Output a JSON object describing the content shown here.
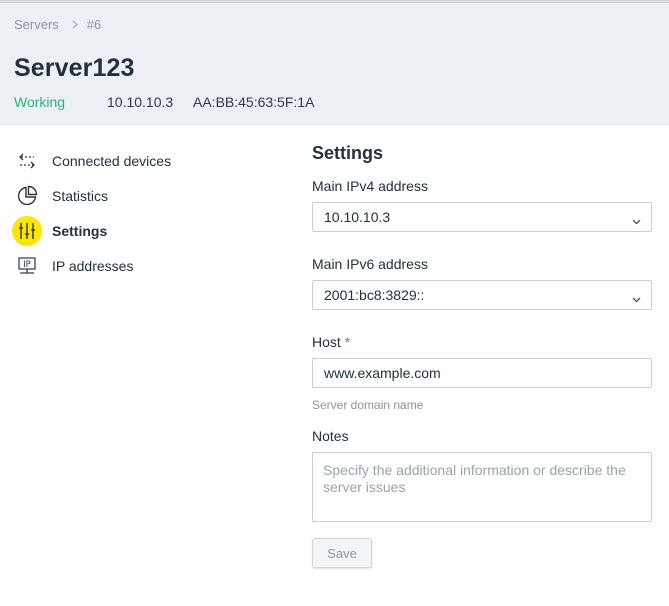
{
  "breadcrumb": {
    "root": "Servers",
    "current": "#6"
  },
  "server": {
    "name": "Server123",
    "status": "Working",
    "status_color": "#2ab27b",
    "ip": "10.10.10.3",
    "mac": "AA:BB:45:63:5F:1A"
  },
  "sidebar": {
    "items": [
      {
        "label": "Connected devices",
        "icon": "connected-devices-icon",
        "active": false
      },
      {
        "label": "Statistics",
        "icon": "pie-chart-icon",
        "active": false
      },
      {
        "label": "Settings",
        "icon": "sliders-icon",
        "active": true
      },
      {
        "label": "IP addresses",
        "icon": "ip-monitor-icon",
        "active": false
      }
    ],
    "active_color": "#ffe600"
  },
  "settings": {
    "title": "Settings",
    "ipv4": {
      "label": "Main IPv4 address",
      "value": "10.10.10.3"
    },
    "ipv6": {
      "label": "Main IPv6 address",
      "value": "2001:bc8:3829::"
    },
    "host": {
      "label": "Host",
      "required_mark": "*",
      "value": "www.example.com",
      "hint": "Server domain name"
    },
    "notes": {
      "label": "Notes",
      "placeholder": "Specify the additional information or describe the server issues",
      "value": ""
    },
    "save_label": "Save"
  }
}
